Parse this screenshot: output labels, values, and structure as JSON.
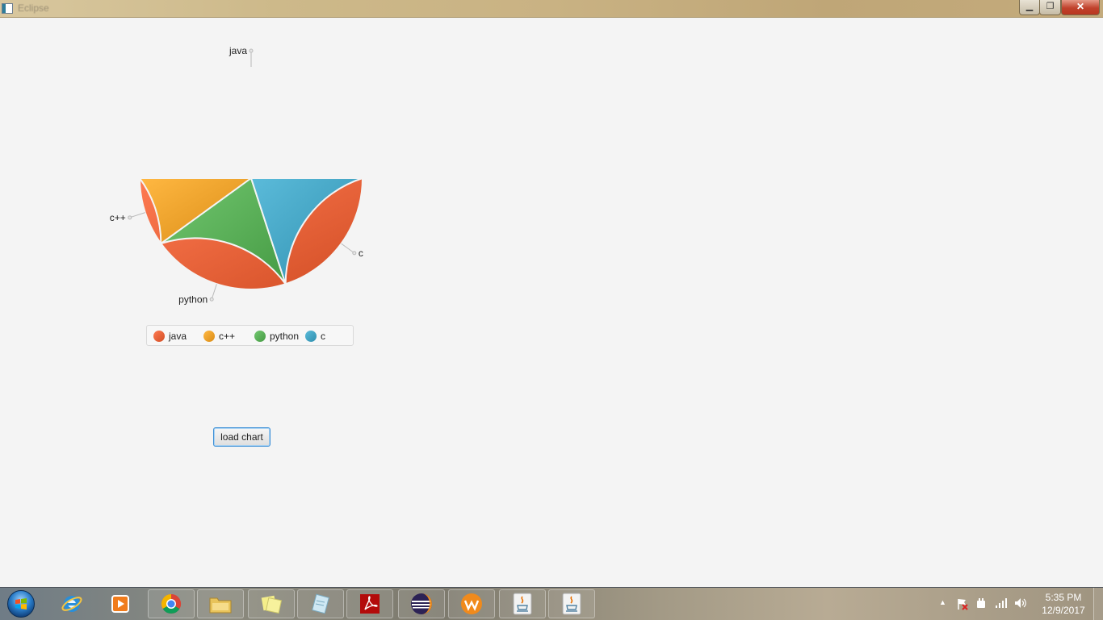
{
  "window": {
    "title": "Eclipse",
    "minimize_glyph": "▁",
    "maximize_glyph": "❐",
    "close_glyph": "✕"
  },
  "chart_data": {
    "type": "pie",
    "slices": [
      {
        "label": "java",
        "value": 50,
        "color": "#e8643b"
      },
      {
        "label": "c++",
        "value": 10,
        "color": "#f0a22c"
      },
      {
        "label": "python",
        "value": 20,
        "color": "#5cb15a"
      },
      {
        "label": "c",
        "value": 20,
        "color": "#45a5c4"
      }
    ],
    "start_angle_deg": 0,
    "direction": "clockwise",
    "legend": [
      "java",
      "c++",
      "python",
      "c"
    ],
    "legend_placement": "bottom",
    "title": ""
  },
  "button": {
    "load_chart_label": "load chart"
  },
  "taskbar": {
    "items": [
      {
        "name": "internet-explorer",
        "pinned": false
      },
      {
        "name": "media-player",
        "pinned": false
      },
      {
        "name": "chrome",
        "pinned": true
      },
      {
        "name": "file-explorer",
        "pinned": true
      },
      {
        "name": "sticky-notes",
        "pinned": true
      },
      {
        "name": "notepad",
        "pinned": true
      },
      {
        "name": "adobe-reader",
        "pinned": true
      },
      {
        "name": "eclipse",
        "pinned": true
      },
      {
        "name": "wamp",
        "pinned": true
      },
      {
        "name": "java",
        "pinned": true
      },
      {
        "name": "java",
        "pinned": true
      }
    ],
    "clock_time": "5:35 PM",
    "clock_date": "12/9/2017"
  }
}
